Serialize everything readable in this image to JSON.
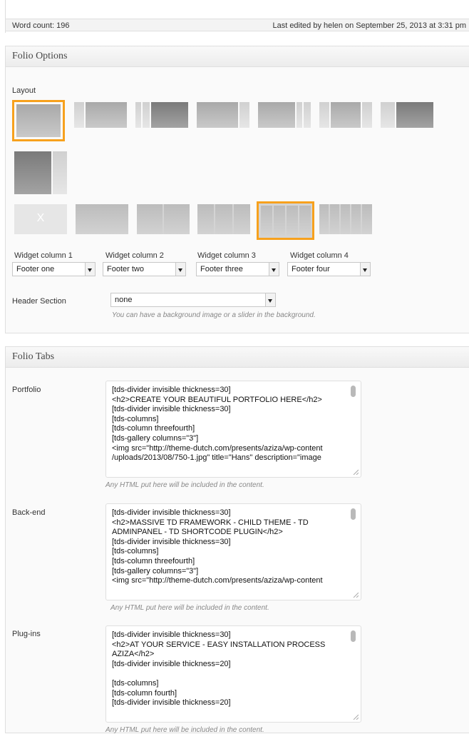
{
  "status": {
    "word_count": "Word count: 196",
    "last_edited": "Last edited by helen on September 25, 2013 at 3:31 pm"
  },
  "folio_options": {
    "title": "Folio Options",
    "layout_label": "Layout",
    "layouts_selected_index": 0,
    "footer_x": "X",
    "footer_selected_index": 4,
    "widget_columns": [
      {
        "label": "Widget column 1",
        "value": "Footer one"
      },
      {
        "label": "Widget column 2",
        "value": "Footer two"
      },
      {
        "label": "Widget column 3",
        "value": "Footer three"
      },
      {
        "label": "Widget column 4",
        "value": "Footer four"
      }
    ],
    "header_section": {
      "label": "Header Section",
      "value": "none",
      "hint": "You can have a background image or a slider in the background."
    }
  },
  "folio_tabs": {
    "title": "Folio Tabs",
    "tabs": [
      {
        "label": "Portfolio",
        "content": "[tds-divider invisible thickness=30]\n<h2>CREATE YOUR BEAUTIFUL PORTFOLIO HERE</h2>\n[tds-divider invisible thickness=30]\n[tds-columns]\n[tds-column threefourth]\n[tds-gallery columns=\"3\"]\n<img src=\"http://theme-dutch.com/presents/aziza/wp-content\n/uploads/2013/08/750-1.jpg\" title=\"Hans\" description=\"image",
        "hint": "Any HTML put here will be included in the content."
      },
      {
        "label": "Back-end",
        "content": "[tds-divider invisible thickness=30]\n<h2>MASSIVE TD FRAMEWORK - CHILD THEME - TD ADMINPANEL - TD SHORTCODE PLUGIN</h2>\n[tds-divider invisible thickness=30]\n[tds-columns]\n[tds-column threefourth]\n[tds-gallery columns=\"3\"]\n<img src=\"http://theme-dutch.com/presents/aziza/wp-content",
        "hint": "Any HTML put here will be included in the content."
      },
      {
        "label": "Plug-ins",
        "content": "[tds-divider invisible thickness=30]\n<h2>AT YOUR SERVICE - EASY INSTALLATION PROCESS AZIZA</h2>\n[tds-divider invisible thickness=20]\n\n[tds-columns]\n[tds-column fourth]\n[tds-divider invisible thickness=20]",
        "hint": "Any HTML put here will be included in the content."
      }
    ]
  },
  "colors": {
    "selected_border": "#f7a11d"
  }
}
